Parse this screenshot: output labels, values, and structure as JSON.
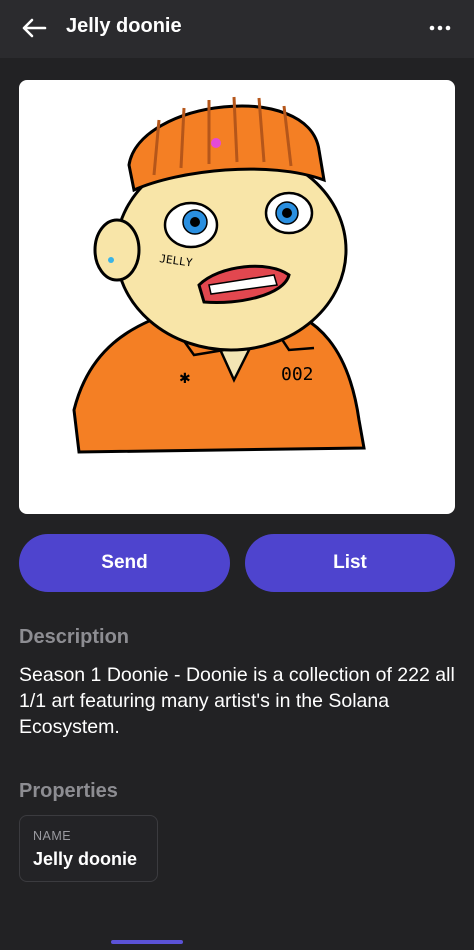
{
  "header": {
    "title": "Jelly doonie",
    "back_icon": "arrow-left-icon",
    "more_icon": "more-horizontal-icon"
  },
  "artwork": {
    "cap_text": "JELLY",
    "shirt_number": "002"
  },
  "actions": {
    "send_label": "Send",
    "list_label": "List",
    "accent_color": "#4e44ce"
  },
  "description": {
    "heading": "Description",
    "text": "Season 1 Doonie - Doonie is a collection of 222 all 1/1 art featuring many artist's in the Solana Ecosystem."
  },
  "properties": {
    "heading": "Properties",
    "items": [
      {
        "key": "NAME",
        "value": "Jelly doonie"
      }
    ]
  }
}
